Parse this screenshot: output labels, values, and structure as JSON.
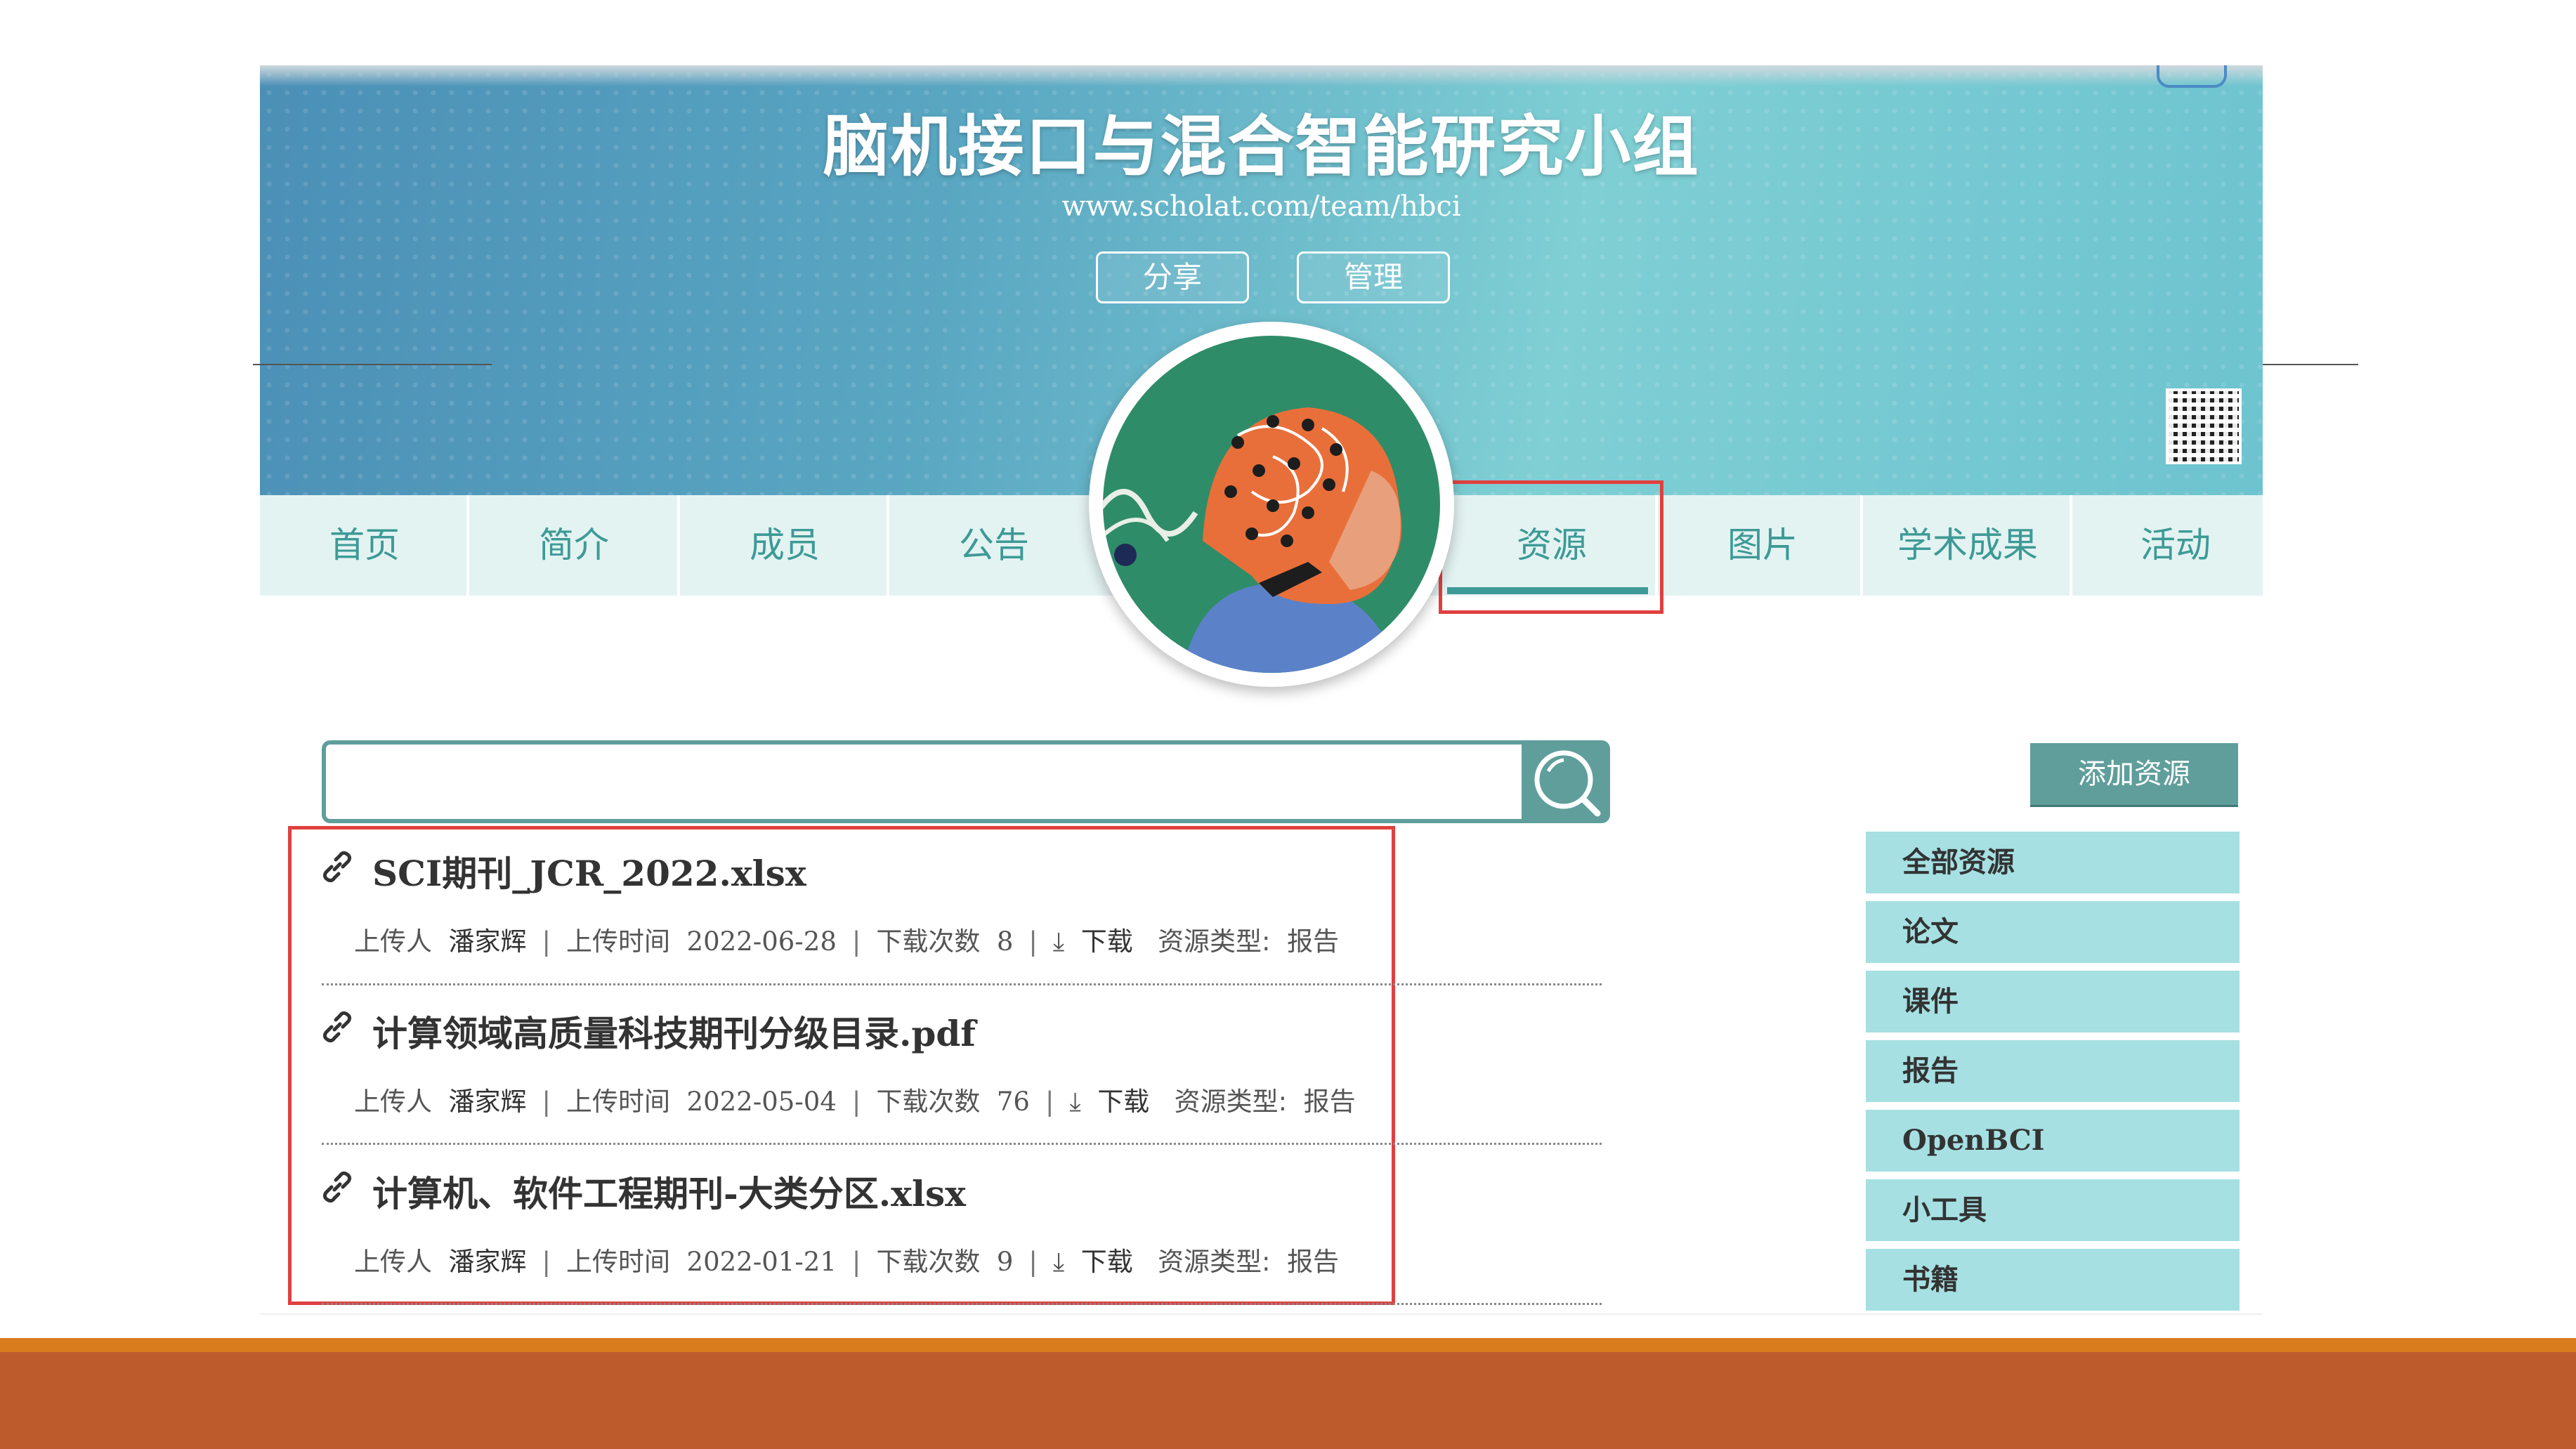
{
  "banner": {
    "title": "脑机接口与混合智能研究小组",
    "url": "www.scholat.com/team/hbci",
    "share_label": "分享",
    "manage_label": "管理"
  },
  "nav": {
    "items": [
      {
        "label": "首页"
      },
      {
        "label": "简介"
      },
      {
        "label": "成员"
      },
      {
        "label": "公告"
      },
      {
        "label": "资源"
      },
      {
        "label": "图片"
      },
      {
        "label": "学术成果"
      },
      {
        "label": "活动"
      }
    ],
    "active": "资源"
  },
  "search": {
    "value": "",
    "placeholder": ""
  },
  "resources": [
    {
      "title": "SCI期刊_JCR_2022.xlsx",
      "uploader_label": "上传人",
      "uploader": "潘家辉",
      "time_label": "上传时间",
      "time": "2022-06-28",
      "count_label": "下载次数",
      "count": "8",
      "download_label": "下载",
      "type_label": "资源类型:",
      "type": "报告"
    },
    {
      "title": "计算领域高质量科技期刊分级目录.pdf",
      "uploader_label": "上传人",
      "uploader": "潘家辉",
      "time_label": "上传时间",
      "time": "2022-05-04",
      "count_label": "下载次数",
      "count": "76",
      "download_label": "下载",
      "type_label": "资源类型:",
      "type": "报告"
    },
    {
      "title": "计算机、软件工程期刊-大类分区.xlsx",
      "uploader_label": "上传人",
      "uploader": "潘家辉",
      "time_label": "上传时间",
      "time": "2022-01-21",
      "count_label": "下载次数",
      "count": "9",
      "download_label": "下载",
      "type_label": "资源类型:",
      "type": "报告"
    }
  ],
  "sidebar": {
    "add_label": "添加资源",
    "categories": [
      {
        "label": "全部资源"
      },
      {
        "label": "论文"
      },
      {
        "label": "课件"
      },
      {
        "label": "报告"
      },
      {
        "label": "OpenBCI"
      },
      {
        "label": "小工具"
      },
      {
        "label": "书籍"
      }
    ]
  },
  "colors": {
    "accent": "#3d9a96",
    "highlight": "#e04040",
    "category_bg": "#a6e0e2",
    "footer": "#bd5b2c"
  },
  "icons": [
    "link-icon",
    "download-icon",
    "search-icon",
    "qr-code-icon",
    "avatar-image"
  ]
}
